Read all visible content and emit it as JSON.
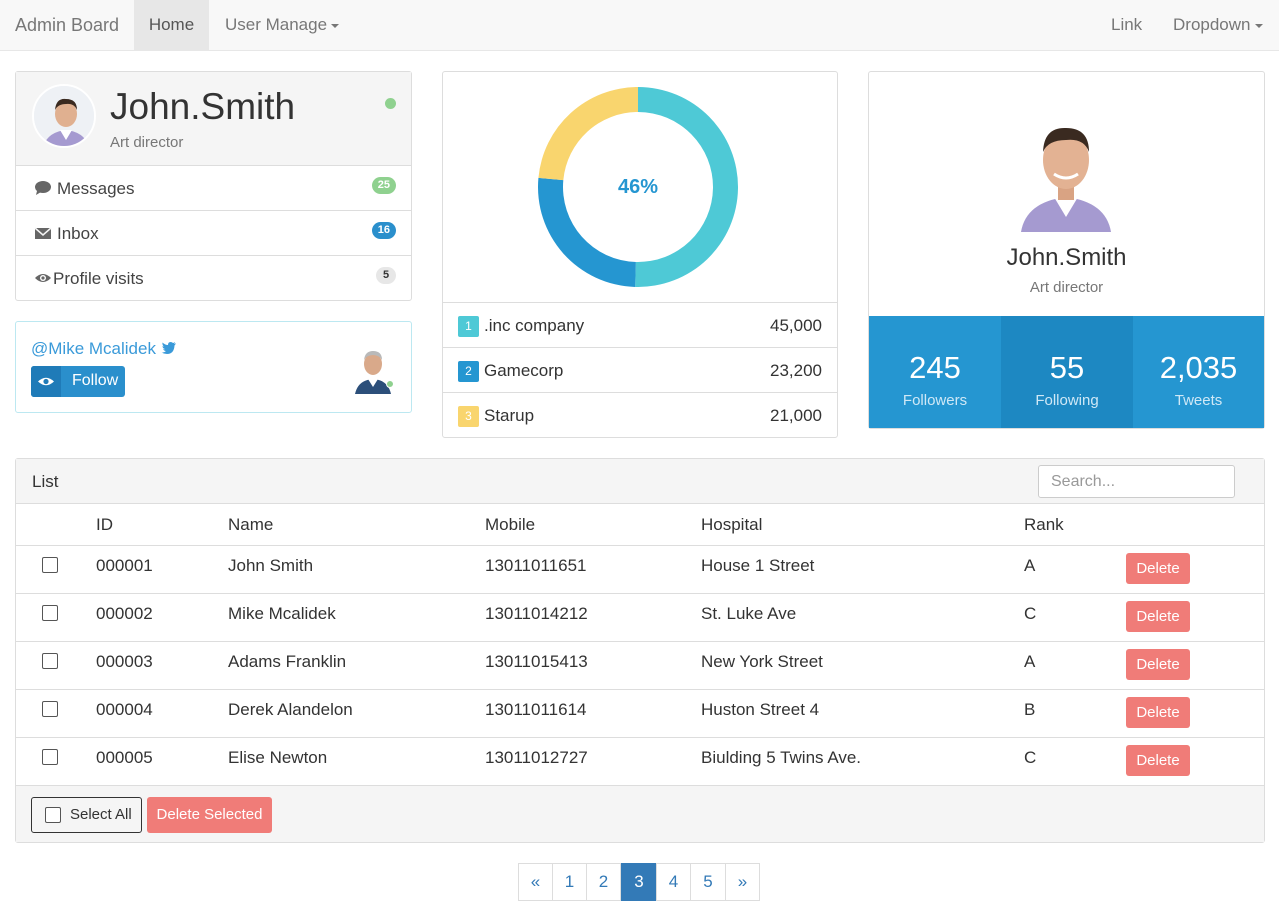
{
  "navbar": {
    "brand": "Admin Board",
    "items": [
      {
        "label": "Home",
        "active": true
      },
      {
        "label": "User Manage",
        "has_caret": true
      }
    ],
    "right": [
      {
        "label": "Link"
      },
      {
        "label": "Dropdown",
        "has_caret": true
      }
    ]
  },
  "profile": {
    "name": "John.Smith",
    "role": "Art director",
    "status_color": "#8fd18f",
    "rows": [
      {
        "icon": "comment-icon",
        "label": "Messages",
        "count": "25",
        "badge_color": "#8fd18f"
      },
      {
        "icon": "envelope-icon",
        "label": "Inbox",
        "count": "16",
        "badge_color": "#2a8fcc"
      },
      {
        "icon": "eye-icon",
        "label": "Profile visits",
        "count": "5",
        "badge_color": "#e7e7e7"
      }
    ]
  },
  "twitter": {
    "handle": "@Mike Mcalidek",
    "follow_label": "Follow"
  },
  "donut": {
    "center_label": "46%",
    "segments": [
      {
        "rank": "1",
        "name": ".inc company",
        "value": "45,000",
        "amount": 45000,
        "color": "#4ec9d6"
      },
      {
        "rank": "2",
        "name": "Gamecorp",
        "value": "23,200",
        "amount": 23200,
        "color": "#2596d1"
      },
      {
        "rank": "3",
        "name": "Starup",
        "value": "21,000",
        "amount": 21000,
        "color": "#f9d56e"
      }
    ]
  },
  "card": {
    "name": "John.Smith",
    "role": "Art director",
    "stats": [
      {
        "value": "245",
        "label": "Followers",
        "bg": "#2596d1"
      },
      {
        "value": "55",
        "label": "Following",
        "bg": "#1d88c2"
      },
      {
        "value": "2,035",
        "label": "Tweets",
        "bg": "#2596d1"
      }
    ]
  },
  "list": {
    "title": "List",
    "search_placeholder": "Search...",
    "columns": [
      "ID",
      "Name",
      "Mobile",
      "Hospital",
      "Rank"
    ],
    "rows": [
      {
        "id": "000001",
        "name": "John Smith",
        "mobile": "13011011651",
        "hospital": "House 1 Street",
        "rank": "A"
      },
      {
        "id": "000002",
        "name": "Mike Mcalidek",
        "mobile": "13011014212",
        "hospital": "St. Luke Ave",
        "rank": "C"
      },
      {
        "id": "000003",
        "name": "Adams Franklin",
        "mobile": "13011015413",
        "hospital": "New York Street",
        "rank": "A"
      },
      {
        "id": "000004",
        "name": "Derek Alandelon",
        "mobile": "13011011614",
        "hospital": "Huston Street 4",
        "rank": "B"
      },
      {
        "id": "000005",
        "name": "Elise Newton",
        "mobile": "13011012727",
        "hospital": "Biulding 5 Twins Ave.",
        "rank": "C"
      }
    ],
    "delete_label": "Delete",
    "select_all_label": "Select All",
    "delete_selected_label": "Delete Selected"
  },
  "pagination": {
    "items": [
      "«",
      "1",
      "2",
      "3",
      "4",
      "5",
      "»"
    ],
    "active": "3"
  }
}
